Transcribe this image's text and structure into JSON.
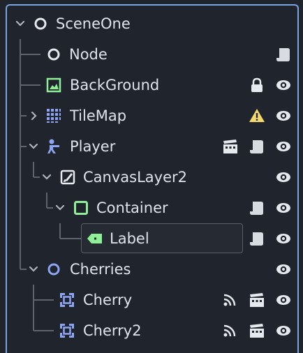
{
  "tree": {
    "root_label": "SceneOne",
    "nodes": [
      {
        "label": "Node"
      },
      {
        "label": "BackGround"
      },
      {
        "label": "TileMap"
      },
      {
        "label": "Player"
      },
      {
        "label": "CanvasLayer2"
      },
      {
        "label": "Container"
      },
      {
        "label": "Label"
      },
      {
        "label": "Cherries"
      },
      {
        "label": "Cherry"
      },
      {
        "label": "Cherry2"
      }
    ]
  },
  "colors": {
    "panel_bg": "#20242c",
    "focus_border": "#7aa4df",
    "text": "#dfe3ea",
    "tree_line": "#5e636d",
    "node_icon_white": "#e6e9ee",
    "node_icon_blue": "#8da5f3",
    "node_icon_green": "#8eef97",
    "warning_yellow": "#f5d86a"
  }
}
